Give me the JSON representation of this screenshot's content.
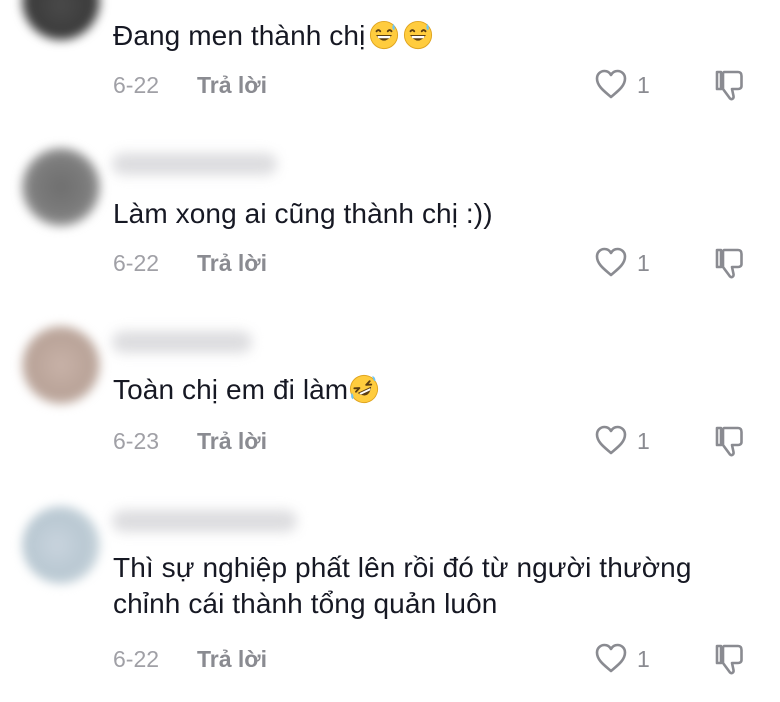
{
  "comments": [
    {
      "text": "Đang men thành chị",
      "emoji": [
        "grinning-sweat-emoji",
        "grinning-sweat-emoji"
      ],
      "date": "6-22",
      "reply_label": "Trả lời",
      "likes": "1"
    },
    {
      "text": "Làm xong ai cũng thành chị :))",
      "emoji": [],
      "date": "6-22",
      "reply_label": "Trả lời",
      "likes": "1"
    },
    {
      "text": "Toàn chị em đi làm",
      "emoji": [
        "rolling-laughing-emoji"
      ],
      "date": "6-23",
      "reply_label": "Trả lời",
      "likes": "1"
    },
    {
      "text_line1": "Thì sự nghiệp phất lên rồi đó từ người thường",
      "text_line2": "chỉnh cái thành tổng quản luôn",
      "emoji": [],
      "date": "6-22",
      "reply_label": "Trả lời",
      "likes": "1"
    }
  ],
  "colors": {
    "text": "#161823",
    "meta": "#8a8b91",
    "date": "#a0a0a6",
    "emoji_face": "#ffcc3e"
  }
}
